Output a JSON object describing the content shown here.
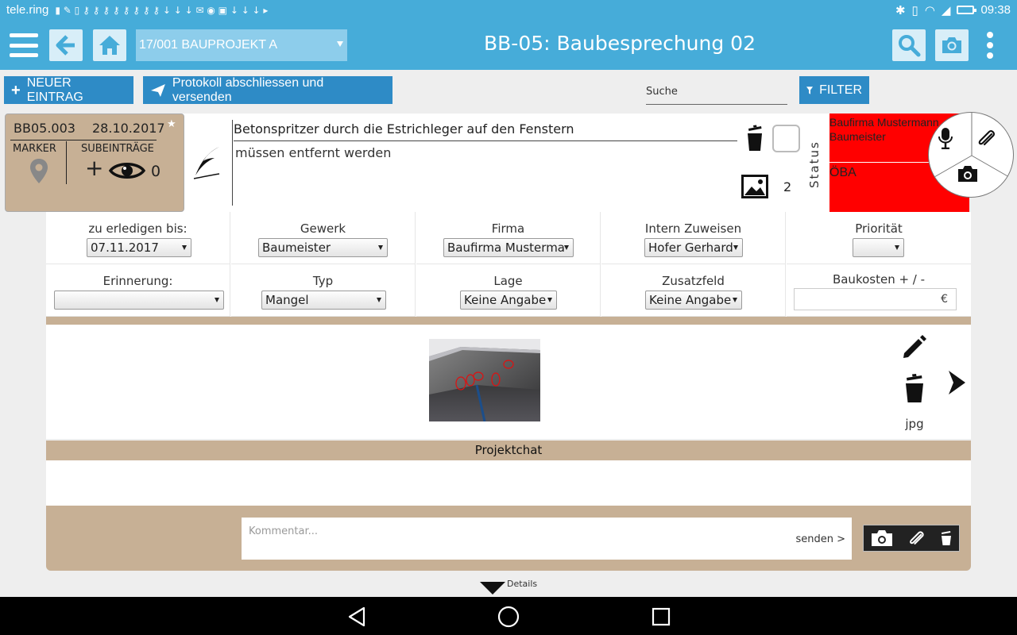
{
  "statusbar": {
    "carrier": "tele.ring",
    "time": "09:38",
    "icons_hint": "▮ ✎ ▯ ⚷ ⚷ ⚷ ⚷ ⚷ ⚷ ⚷ ⚷ ↓ ↓ ↓ ✉ ◉ ▣ ↓ ↓ ↓ ▸"
  },
  "appbar": {
    "project": "17/001 BAUPROJEKT A",
    "title": "BB-05: Baubesprechung 02"
  },
  "toolbar": {
    "new_entry": "NEUER EINTRAG",
    "close_protocol": "Protokoll abschliessen und versenden",
    "search_placeholder": "Suche",
    "filter": "FILTER"
  },
  "entry": {
    "id": "BB05.003",
    "date": "28.10.2017",
    "marker_label": "MARKER",
    "subentries_label": "SUBEINTRÄGE",
    "subentries_count": "0",
    "title": "Betonspritzer durch die Estrichleger auf den Fenstern",
    "description": "müssen entfernt werden",
    "image_count": "2",
    "status_label": "Status",
    "assignee_top": "Baufirma Mustermann Baumeister",
    "assignee_bottom": "ÖBA",
    "status_color": "#ff0000"
  },
  "details": {
    "row1": [
      {
        "label": "zu erledigen bis:",
        "value": "07.11.2017"
      },
      {
        "label": "Gewerk",
        "value": "Baumeister"
      },
      {
        "label": "Firma",
        "value": "Baufirma Musterma"
      },
      {
        "label": "Intern Zuweisen",
        "value": "Hofer Gerhard"
      },
      {
        "label": "Priorität",
        "value": ""
      }
    ],
    "row2": [
      {
        "label": "Erinnerung:",
        "value": ""
      },
      {
        "label": "Typ",
        "value": "Mangel"
      },
      {
        "label": "Lage",
        "value": "Keine Angabe"
      },
      {
        "label": "Zusatzfeld",
        "value": "Keine Angabe"
      },
      {
        "label": "Baukosten + / -",
        "value": "€"
      }
    ]
  },
  "media": {
    "file_type": "jpg"
  },
  "chat": {
    "header": "Projektchat",
    "placeholder": "Kommentar...",
    "send": "senden >"
  },
  "footer": {
    "details": "Details"
  },
  "colors": {
    "primary": "#46acd9",
    "button": "#2e8bc6",
    "tan": "#c7b095",
    "status_red": "#ff0000"
  }
}
